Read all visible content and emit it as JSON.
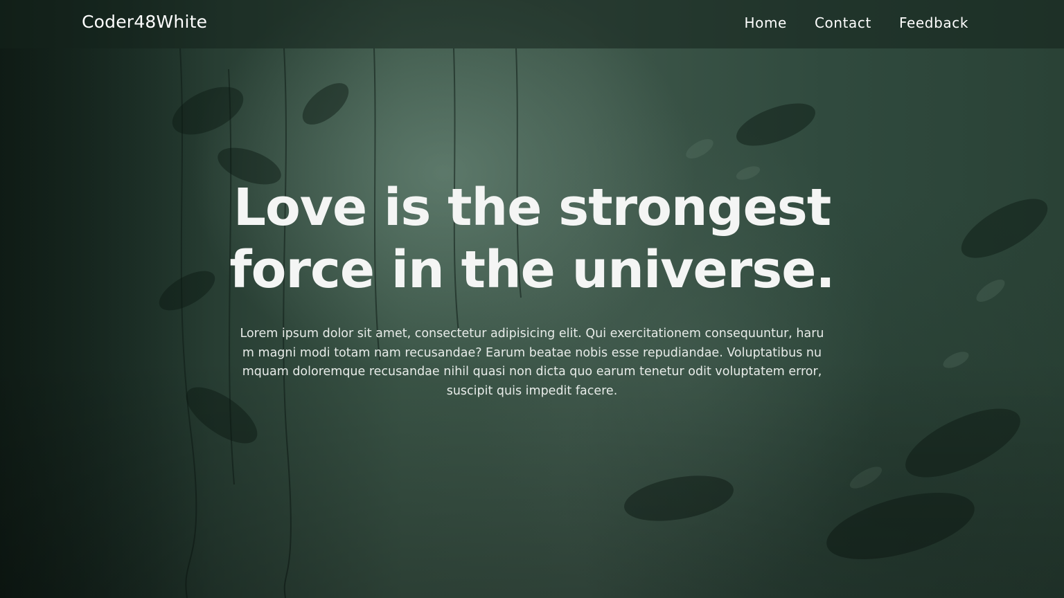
{
  "header": {
    "brand": "Coder48White",
    "nav": [
      {
        "label": "Home"
      },
      {
        "label": "Contact"
      },
      {
        "label": "Feedback"
      }
    ]
  },
  "hero": {
    "title_line1": "Love is the strongest",
    "title_line2": "force in the universe.",
    "body": "Lorem ipsum dolor sit amet, consectetur adipisicing elit. Qui exercitationem consequuntur, harum magni modi totam nam recusandae? Earum beatae nobis esse repudiandae. Voluptatibus numquam doloremque recusandae nihil quasi non dicta quo earum tenetur odit voluptatem error, suscipit quis impedit facere."
  },
  "colors": {
    "background_tint": "#2c4237",
    "text": "#ffffff"
  }
}
